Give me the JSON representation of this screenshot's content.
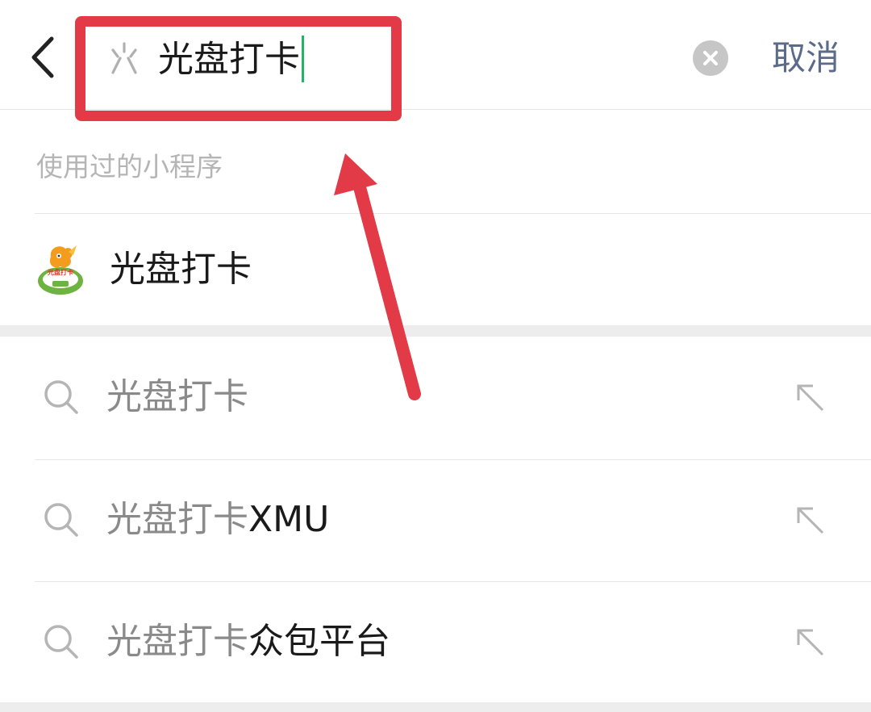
{
  "header": {
    "search_value": "光盘打卡",
    "cancel_label": "取消"
  },
  "used_section": {
    "title": "使用过的小程序",
    "items": [
      {
        "name": "光盘打卡",
        "logo_text": "光盘打卡"
      }
    ]
  },
  "suggestions": [
    {
      "match": "光盘打卡",
      "rest": ""
    },
    {
      "match": "光盘打卡",
      "rest": "XMU"
    },
    {
      "match": "光盘打卡",
      "rest": "众包平台"
    }
  ],
  "colors": {
    "annotation_red": "#e23a46",
    "caret_green": "#22b26a",
    "link_blue": "#5b6b89"
  }
}
